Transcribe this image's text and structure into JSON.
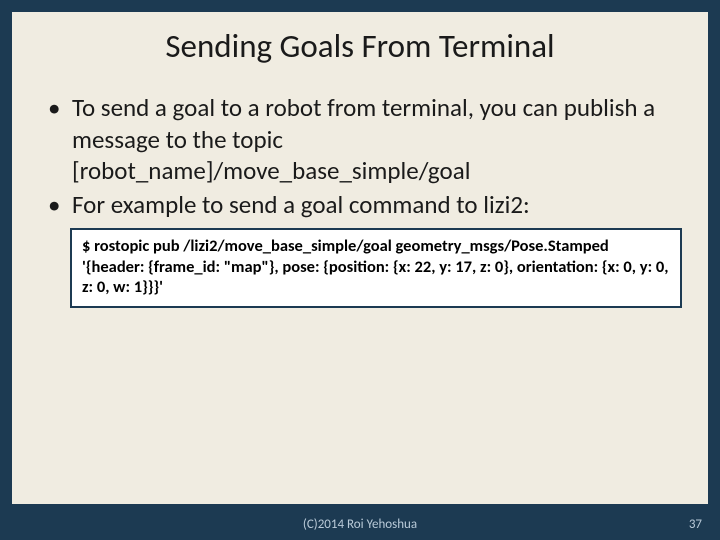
{
  "slide": {
    "title": "Sending Goals From Terminal",
    "bullets": [
      "To send a goal to a robot from terminal, you can publish a message to the topic [robot_name]/move_base_simple/goal",
      "For example to send a goal command to lizi2:"
    ],
    "code": {
      "line1": "$ rostopic pub /lizi2/move_base_simple/goal geometry_msgs/Pose.Stamped",
      "line2": "'{header: {frame_id: \"map\"}, pose: {position: {x: 22, y: 17, z: 0}, orientation: {x: 0, y: 0, z: 0, w: 1}}}'"
    }
  },
  "footer": {
    "copyright": "(C)2014 Roi Yehoshua",
    "page_number": "37"
  }
}
